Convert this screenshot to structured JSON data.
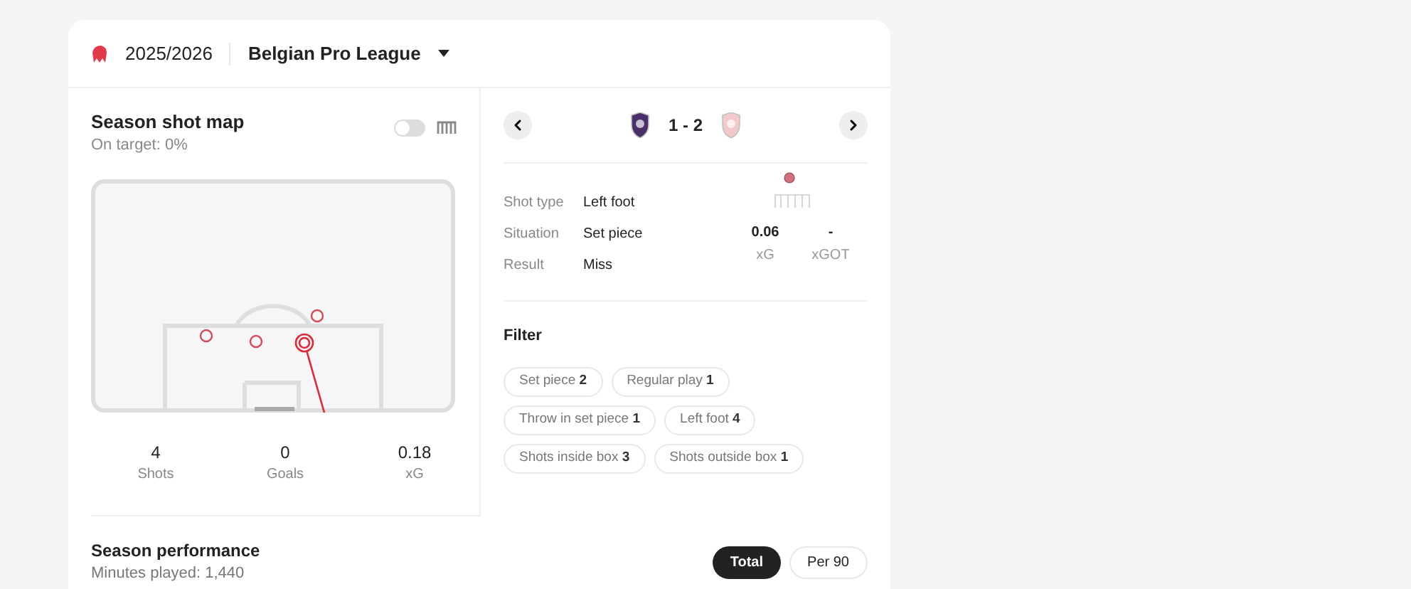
{
  "header": {
    "season": "2025/2026",
    "league": "Belgian Pro League"
  },
  "shot_map": {
    "title": "Season shot map",
    "subtitle": "On target: 0%",
    "toggle": {
      "on": false
    },
    "stats": [
      {
        "value": "4",
        "label": "Shots"
      },
      {
        "value": "0",
        "label": "Goals"
      },
      {
        "value": "0.18",
        "label": "xG"
      }
    ]
  },
  "match": {
    "score": "1 - 2"
  },
  "shot_details": {
    "rows": [
      {
        "label": "Shot type",
        "value": "Left foot"
      },
      {
        "label": "Situation",
        "value": "Set piece"
      },
      {
        "label": "Result",
        "value": "Miss"
      }
    ],
    "metrics": [
      {
        "value": "0.06",
        "label": "xG"
      },
      {
        "value": "-",
        "label": "xGOT"
      }
    ]
  },
  "filter": {
    "title": "Filter",
    "chips": [
      {
        "label": "Set piece",
        "count": "2"
      },
      {
        "label": "Regular play",
        "count": "1"
      },
      {
        "label": "Throw in set piece",
        "count": "1"
      },
      {
        "label": "Left foot",
        "count": "4"
      },
      {
        "label": "Shots inside box",
        "count": "3"
      },
      {
        "label": "Shots outside box",
        "count": "1"
      }
    ]
  },
  "performance": {
    "title": "Season performance",
    "subtitle": "Minutes played: 1,440",
    "modes": [
      {
        "label": "Total",
        "selected": true
      },
      {
        "label": "Per 90",
        "selected": false
      }
    ]
  }
}
